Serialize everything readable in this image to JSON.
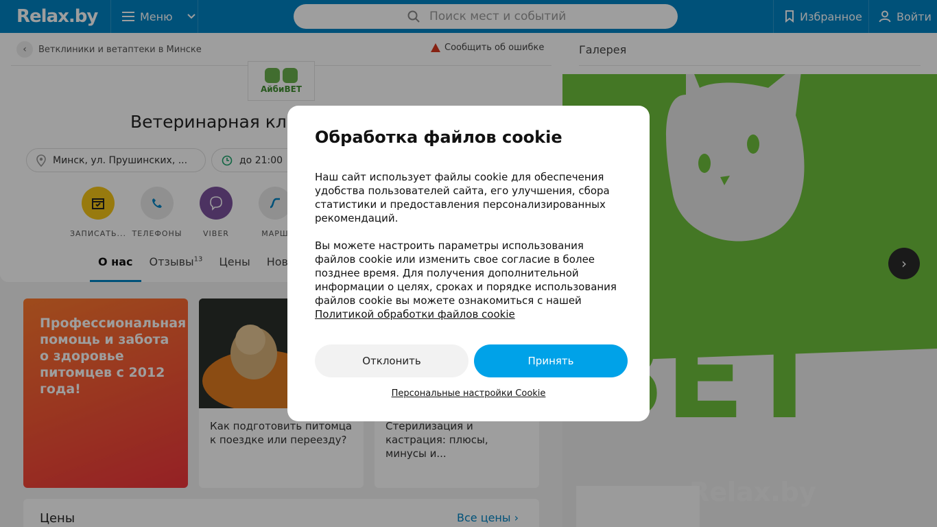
{
  "header": {
    "logo": "Relax.by",
    "menu_label": "Меню",
    "search_placeholder": "Поиск мест и событий",
    "favorites_label": "Избранное",
    "login_label": "Войти"
  },
  "breadcrumb": {
    "label": "Ветклиники и ветаптеки в Минске",
    "report_label": "Сообщить об ошибке"
  },
  "clinic": {
    "logo_text": "АйбиВЕТ",
    "title": "Ветеринарная кли",
    "address": "Минск, ул. Прушинских, ...",
    "hours": "до 21:00"
  },
  "actions": [
    {
      "label": "ЗАПИСАТЬ...",
      "icon": "calendar-icon",
      "color": "#f5c518"
    },
    {
      "label": "ТЕЛЕФОНЫ",
      "icon": "phone-icon",
      "color": "#e9e9e9"
    },
    {
      "label": "VIBER",
      "icon": "viber-icon",
      "color": "#7b519d"
    },
    {
      "label": "МАРШ",
      "icon": "route-icon",
      "color": "#e9e9e9"
    }
  ],
  "tabs": [
    {
      "label": "О нас",
      "count": ""
    },
    {
      "label": "Отзывы",
      "count": "13"
    },
    {
      "label": "Цены",
      "count": ""
    },
    {
      "label": "Ново",
      "count": ""
    }
  ],
  "promo": {
    "text": "Профессиональная помощь и забота о здоровье питомцев с 2012 года!"
  },
  "articles": [
    {
      "caption": "Как подготовить питомца к поездке или переезду?"
    },
    {
      "caption": "Стерилизация и кастрация: плюсы, минусы и..."
    }
  ],
  "prices": {
    "title": "Цены",
    "all_link": "Все цены"
  },
  "gallery": {
    "title": "Галерея",
    "watermark": "Relax.by",
    "sign_text": "ВЕТ"
  },
  "cookie_modal": {
    "title": "Обработка файлов cookie",
    "paragraph1": "Наш сайт использует файлы cookie для обеспечения удобства пользователей сайта, его улучшения, сбора статистики и предоставления персонализированных рекомендаций.",
    "paragraph2": "Вы можете настроить параметры использования файлов cookie или изменить свое согласие в более позднее время. Для получения дополнительной информации о целях, сроках и порядке использования файлов cookie вы можете ознакомиться с нашей",
    "policy_link": "Политикой обработки файлов cookie",
    "decline_label": "Отклонить",
    "accept_label": "Принять",
    "settings_link": "Персональные настройки Cookie"
  },
  "colors": {
    "brand": "#0084c4",
    "accept": "#00a2e8"
  }
}
